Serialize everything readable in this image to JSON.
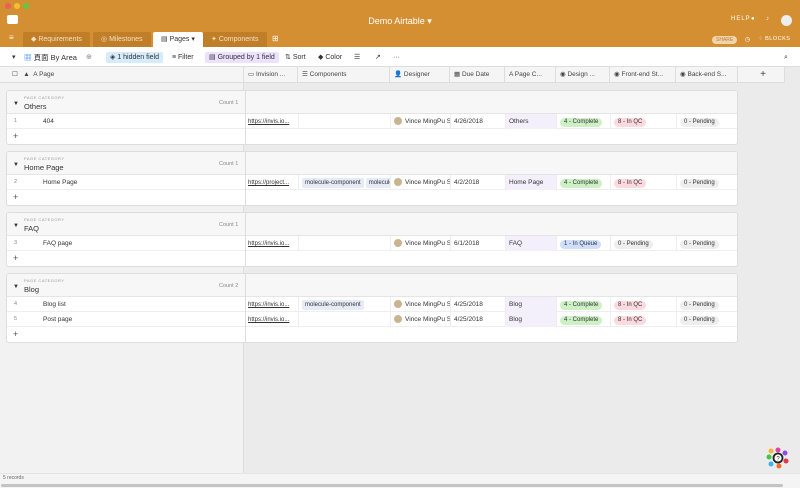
{
  "window": {
    "title": "Demo Airtable",
    "help": "HELP",
    "share": "SHARE",
    "blocks": "BLOCKS"
  },
  "colors": {
    "brand": "#d48f32",
    "complete": "#cdf1c4",
    "in_qc": "#fcd9de",
    "pending": "#eeeeee",
    "in_queue": "#cfdffb"
  },
  "tabs": [
    {
      "label": "Requirements",
      "icon": "tag-icon"
    },
    {
      "label": "Milestones",
      "icon": "target-icon"
    },
    {
      "label": "Pages",
      "icon": "book-icon",
      "active": true
    },
    {
      "label": "Components",
      "icon": "puzzle-icon"
    }
  ],
  "toolbar": {
    "view": "頁面 By Area",
    "hidden": "1 hidden field",
    "filter": "Filter",
    "grouped": "Grouped by 1 field",
    "sort": "Sort",
    "color": "Color",
    "more": "···"
  },
  "columns": [
    "Page",
    "Invision ...",
    "Components",
    "Designer",
    "Due Date",
    "Page C...",
    "Design ...",
    "Front-end St...",
    "Back-end S..."
  ],
  "groups": [
    {
      "label": "PAGE CATEGORY",
      "name": "Others",
      "count": "Count 1",
      "rows": [
        {
          "n": "1",
          "page": "404",
          "invision": "https://invis.io...",
          "components": [],
          "designer": "Vince MingPu Shao",
          "due": "4/26/2018",
          "cat": "Others",
          "design": "4 - Complete",
          "front": "8 - In QC",
          "back": "0 - Pending"
        }
      ]
    },
    {
      "label": "PAGE CATEGORY",
      "name": "Home Page",
      "count": "Count 1",
      "rows": [
        {
          "n": "2",
          "page": "Home Page",
          "invision": "https://project...",
          "components": [
            "molecule-component",
            "molecule-component"
          ],
          "designer": "Vince MingPu Shao",
          "due": "4/2/2018",
          "cat": "Home Page",
          "design": "4 - Complete",
          "front": "8 - In QC",
          "back": "0 - Pending"
        }
      ]
    },
    {
      "label": "PAGE CATEGORY",
      "name": "FAQ",
      "count": "Count 1",
      "rows": [
        {
          "n": "3",
          "page": "FAQ page",
          "invision": "https://invis.io...",
          "components": [],
          "designer": "Vince MingPu Shao",
          "due": "6/1/2018",
          "cat": "FAQ",
          "design": "1 - In Queue",
          "front": "0 - Pending",
          "back": "0 - Pending"
        }
      ]
    },
    {
      "label": "PAGE CATEGORY",
      "name": "Blog",
      "count": "Count 2",
      "rows": [
        {
          "n": "4",
          "page": "Blog list",
          "invision": "https://invis.io...",
          "components": [
            "molecule-component"
          ],
          "designer": "Vince MingPu Shao",
          "due": "4/25/2018",
          "cat": "Blog",
          "design": "4 - Complete",
          "front": "8 - In QC",
          "back": "0 - Pending"
        },
        {
          "n": "5",
          "page": "Post page",
          "invision": "https://invis.io...",
          "components": [],
          "designer": "Vince MingPu Shao",
          "due": "4/25/2018",
          "cat": "Blog",
          "design": "4 - Complete",
          "front": "8 - In QC",
          "back": "0 - Pending"
        }
      ]
    }
  ],
  "footer": {
    "records": "5 records"
  }
}
